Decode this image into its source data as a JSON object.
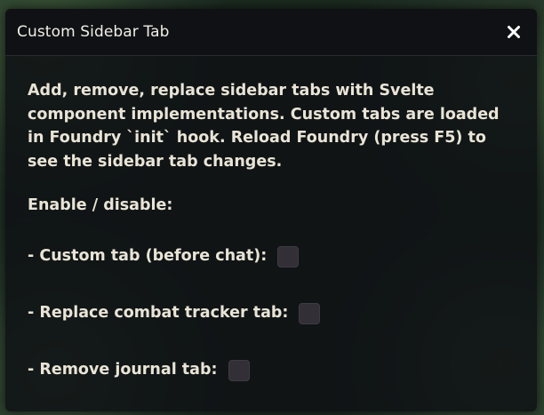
{
  "window": {
    "title": "Custom Sidebar Tab",
    "close_icon": "close-icon"
  },
  "content": {
    "description": "Add, remove, replace sidebar tabs with Svelte component implementations. Custom tabs are loaded in Foundry `init` hook. Reload Foundry (press F5) to see the sidebar tab changes.",
    "enable_label": "Enable / disable:",
    "options": [
      {
        "label": "- Custom tab (before chat):",
        "checked": false
      },
      {
        "label": "- Replace combat tracker tab:",
        "checked": false
      },
      {
        "label": "- Remove journal tab:",
        "checked": false
      }
    ]
  },
  "colors": {
    "panel_background": "#0e1014",
    "text": "#e9e4d6",
    "checkbox_fill": "#322f36"
  }
}
